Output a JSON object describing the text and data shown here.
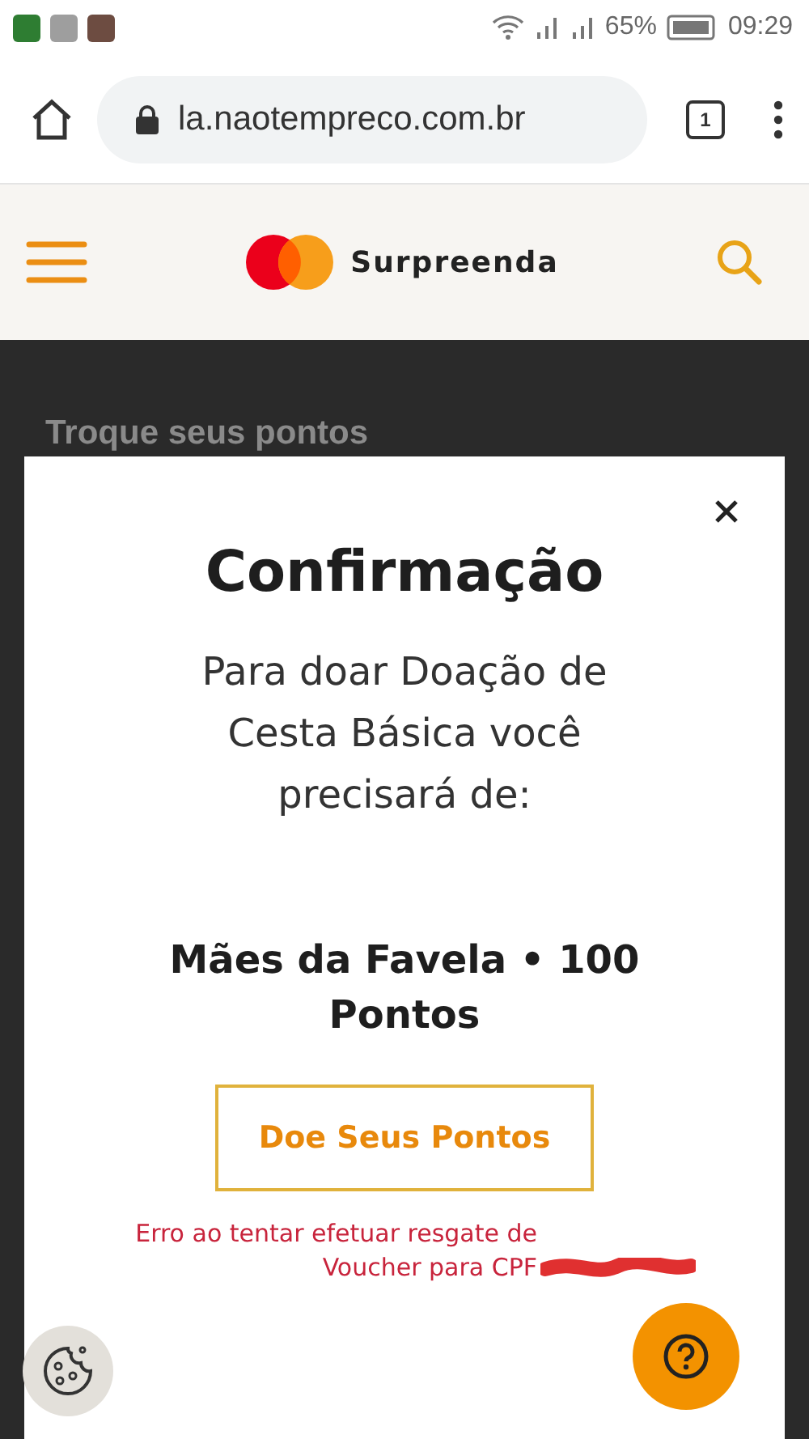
{
  "status_bar": {
    "battery": "65%",
    "time": "09:29"
  },
  "browser": {
    "url": "la.naotempreco.com.br",
    "tab_count": "1"
  },
  "site_header": {
    "brand": "Surpreenda"
  },
  "page": {
    "heading": "Troque seus pontos"
  },
  "modal": {
    "title": "Confirmação",
    "message": "Para doar Doação de Cesta Básica você precisará de:",
    "cost": "Mães da Favela • 100 Pontos",
    "button": "Doe Seus Pontos",
    "error": "Erro ao tentar efetuar resgate de Voucher para CPF",
    "error_redacted": true
  }
}
